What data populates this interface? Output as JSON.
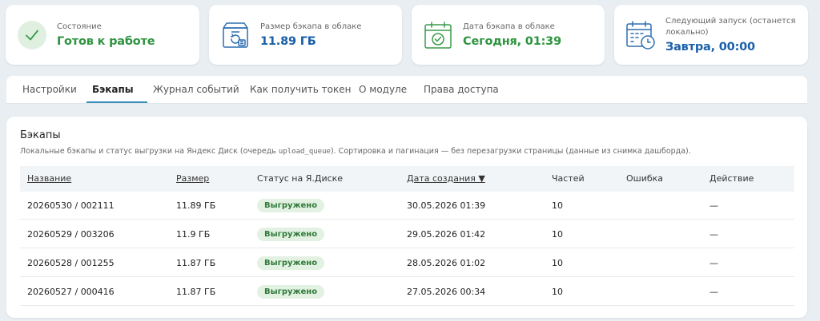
{
  "status_cards": [
    {
      "label": "Состояние",
      "value": "Готов к работе",
      "icon": "check-circle-icon",
      "color": "#2e9440"
    },
    {
      "label": "Размер бэкапа в облаке",
      "value": "11.89 ГБ",
      "icon": "backup-box-icon",
      "color": "#1a5fa8"
    },
    {
      "label": "Дата бэкапа в облаке",
      "value": "Сегодня, 01:39",
      "icon": "calendar-check-icon",
      "color": "#2e9440"
    },
    {
      "label": "Следующий запуск (останется локально)",
      "value": "Завтра, 00:00",
      "icon": "calendar-clock-icon",
      "color": "#1a5fa8"
    }
  ],
  "tabs": [
    {
      "label": "Настройки",
      "active": false
    },
    {
      "label": "Бэкапы",
      "active": true
    },
    {
      "label": "Журнал событий",
      "active": false
    },
    {
      "label": "Как получить токен",
      "active": false
    },
    {
      "label": "О модуле",
      "active": false
    },
    {
      "label": "Права доступа",
      "active": false
    }
  ],
  "backups": {
    "title": "Бэкапы",
    "desc_before": "Локальные бэкапы и статус выгрузки на Яндекс Диск (очередь ",
    "desc_code": "upload_queue",
    "desc_after": "). Сортировка и пагинация — без перезагрузки страницы (данные из снимка дашборда).",
    "columns": [
      "Название",
      "Размер",
      "Статус на Я.Диске",
      "Дата создания ▼",
      "Частей",
      "Ошибка",
      "Действие"
    ],
    "rows": [
      {
        "name": "20260530 / 002111",
        "size": "11.89 ГБ",
        "status": "Выгружено",
        "date": "30.05.2026 01:39",
        "parts": "10",
        "error": "",
        "action": "—"
      },
      {
        "name": "20260529 / 003206",
        "size": "11.9 ГБ",
        "status": "Выгружено",
        "date": "29.05.2026 01:42",
        "parts": "10",
        "error": "",
        "action": "—"
      },
      {
        "name": "20260528 / 001255",
        "size": "11.87 ГБ",
        "status": "Выгружено",
        "date": "28.05.2026 01:02",
        "parts": "10",
        "error": "",
        "action": "—"
      },
      {
        "name": "20260527 / 000416",
        "size": "11.87 ГБ",
        "status": "Выгружено",
        "date": "27.05.2026 00:34",
        "parts": "10",
        "error": "",
        "action": "—"
      }
    ]
  }
}
